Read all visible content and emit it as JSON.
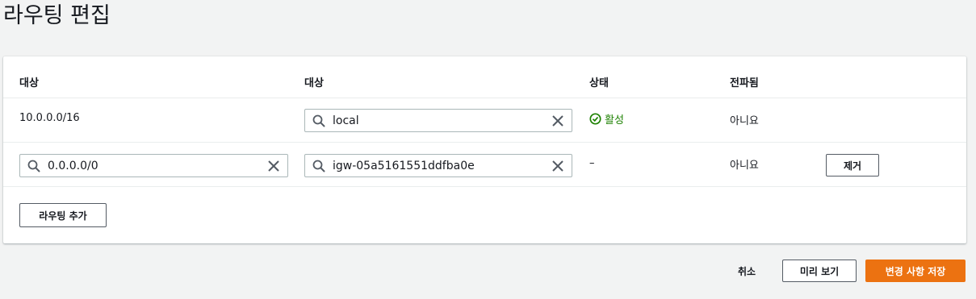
{
  "page": {
    "title": "라우팅 편집"
  },
  "table": {
    "headers": [
      "대상",
      "대상",
      "상태",
      "전파됨"
    ],
    "rows": [
      {
        "destination": "10.0.0.0/16",
        "target": "local",
        "status": "활성",
        "propagated": "아니요"
      },
      {
        "destination": "0.0.0.0/0",
        "target": "igw-05a5161551ddfba0e",
        "status": "–",
        "propagated": "아니요",
        "remove_label": "제거"
      }
    ],
    "add_route_label": "라우팅 추가"
  },
  "footer": {
    "cancel_label": "취소",
    "preview_label": "미리 보기",
    "save_label": "변경 사항 저장"
  },
  "colors": {
    "primary": "#ec7211",
    "active": "#1d8102",
    "border": "#aab7b8"
  }
}
